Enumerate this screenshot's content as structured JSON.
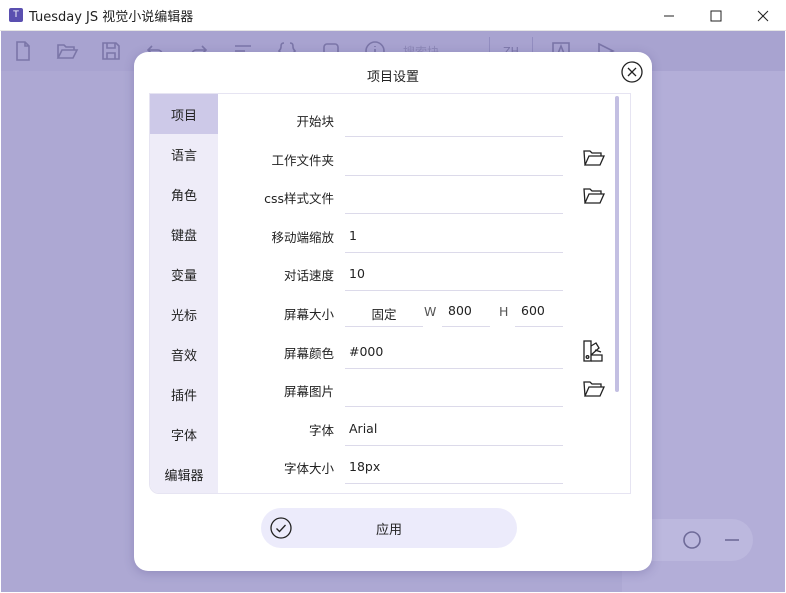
{
  "window": {
    "title": "Tuesday JS 视觉小说编辑器",
    "app_icon_text": "T"
  },
  "toolbar": {
    "search_placeholder": "搜索块",
    "lang_label": "ZH"
  },
  "dialog": {
    "title": "项目设置",
    "apply_label": "应用"
  },
  "sidebar": {
    "items": [
      {
        "label": "项目",
        "active": true
      },
      {
        "label": "语言"
      },
      {
        "label": "角色"
      },
      {
        "label": "键盘"
      },
      {
        "label": "变量"
      },
      {
        "label": "光标"
      },
      {
        "label": "音效"
      },
      {
        "label": "插件"
      },
      {
        "label": "字体"
      },
      {
        "label": "编辑器"
      }
    ]
  },
  "form": {
    "start_block": {
      "label": "开始块",
      "value": ""
    },
    "work_folder": {
      "label": "工作文件夹",
      "value": ""
    },
    "css_file": {
      "label": "css样式文件",
      "value": ""
    },
    "mobile_scale": {
      "label": "移动端缩放",
      "value": "1"
    },
    "dialog_speed": {
      "label": "对话速度",
      "value": "10"
    },
    "screen_size": {
      "label": "屏幕大小",
      "mode": "固定",
      "w_label": "W",
      "w": "800",
      "h_label": "H",
      "h": "600"
    },
    "screen_color": {
      "label": "屏幕颜色",
      "value": "#000"
    },
    "screen_image": {
      "label": "屏幕图片",
      "value": ""
    },
    "font": {
      "label": "字体",
      "value": "Arial"
    },
    "font_size": {
      "label": "字体大小",
      "value": "18px"
    }
  },
  "colors": {
    "app_bg": "#ada8d3",
    "active_tab": "#cdc9e8",
    "sidebar_bg": "#eeecf8",
    "apply_bg": "#ecebfb"
  }
}
